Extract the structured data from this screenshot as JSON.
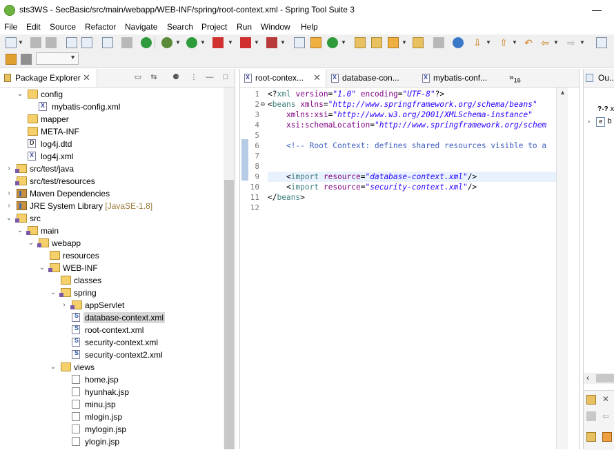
{
  "window": {
    "title": "sts3WS - SecBasic/src/main/webapp/WEB-INF/spring/root-context.xml - Spring Tool Suite 3",
    "minimize": "—"
  },
  "menu": [
    "File",
    "Edit",
    "Source",
    "Refactor",
    "Navigate",
    "Search",
    "Project",
    "Run",
    "Window",
    "Help"
  ],
  "package_explorer": {
    "title": "Package Explorer",
    "close": "✕",
    "tree": [
      {
        "label": "config",
        "icon": "folder",
        "depth": 0,
        "twisty": "open"
      },
      {
        "label": "mybatis-config.xml",
        "icon": "xml-file",
        "depth": 1,
        "twisty": ""
      },
      {
        "label": "mapper",
        "icon": "folder",
        "depth": 0,
        "twisty": ""
      },
      {
        "label": "META-INF",
        "icon": "folder",
        "depth": 0,
        "twisty": ""
      },
      {
        "label": "log4j.dtd",
        "icon": "dtd-file",
        "depth": 0,
        "twisty": ""
      },
      {
        "label": "log4j.xml",
        "icon": "xml-file",
        "depth": 0,
        "twisty": ""
      },
      {
        "label": "src/test/java",
        "icon": "source-folder",
        "depth": -1,
        "twisty": "closed"
      },
      {
        "label": "src/test/resources",
        "icon": "source-folder",
        "depth": -1,
        "twisty": ""
      },
      {
        "label": "Maven Dependencies",
        "icon": "library",
        "depth": -1,
        "twisty": "closed"
      },
      {
        "label": "JRE System Library",
        "suffix": "[JavaSE-1.8]",
        "icon": "library",
        "depth": -1,
        "twisty": "closed"
      },
      {
        "label": "src",
        "icon": "source-folder",
        "depth": -1,
        "twisty": "open"
      },
      {
        "label": "main",
        "icon": "source-folder",
        "depth": 0,
        "twisty": "open"
      },
      {
        "label": "webapp",
        "icon": "source-folder",
        "depth": 1,
        "twisty": "open"
      },
      {
        "label": "resources",
        "icon": "folder",
        "depth": 2,
        "twisty": ""
      },
      {
        "label": "WEB-INF",
        "icon": "source-folder",
        "depth": 2,
        "twisty": "open"
      },
      {
        "label": "classes",
        "icon": "folder",
        "depth": 3,
        "twisty": ""
      },
      {
        "label": "spring",
        "icon": "source-folder",
        "depth": 3,
        "twisty": "open"
      },
      {
        "label": "appServlet",
        "icon": "source-folder",
        "depth": 4,
        "twisty": "closed"
      },
      {
        "label": "database-context.xml",
        "icon": "spring-xml-file",
        "depth": 4,
        "twisty": "",
        "selected": true
      },
      {
        "label": "root-context.xml",
        "icon": "spring-xml-file",
        "depth": 4,
        "twisty": ""
      },
      {
        "label": "security-context.xml",
        "icon": "spring-xml-file",
        "depth": 4,
        "twisty": ""
      },
      {
        "label": "security-context2.xml",
        "icon": "spring-xml-file",
        "depth": 4,
        "twisty": ""
      },
      {
        "label": "views",
        "icon": "folder",
        "depth": 3,
        "twisty": "open"
      },
      {
        "label": "home.jsp",
        "icon": "jsp-file",
        "depth": 4,
        "twisty": ""
      },
      {
        "label": "hyunhak.jsp",
        "icon": "jsp-file",
        "depth": 4,
        "twisty": ""
      },
      {
        "label": "minu.jsp",
        "icon": "jsp-file",
        "depth": 4,
        "twisty": ""
      },
      {
        "label": "mlogin.jsp",
        "icon": "jsp-file",
        "depth": 4,
        "twisty": ""
      },
      {
        "label": "mylogin.jsp",
        "icon": "jsp-file",
        "depth": 4,
        "twisty": ""
      },
      {
        "label": "ylogin.jsp",
        "icon": "jsp-file",
        "depth": 4,
        "twisty": ""
      }
    ]
  },
  "editor": {
    "tabs": [
      {
        "label": "root-contex...",
        "active": true,
        "close": "✕"
      },
      {
        "label": "database-con...",
        "active": false
      },
      {
        "label": "mybatis-conf...",
        "active": false
      }
    ],
    "overflow": {
      "symbol": "»",
      "count": "16"
    },
    "lines": [
      {
        "n": "1",
        "parts": [
          [
            "pun",
            "<?"
          ],
          [
            "tag",
            "xml"
          ],
          [
            "pun",
            " "
          ],
          [
            "attr",
            "version"
          ],
          [
            "pun",
            "="
          ],
          [
            "str",
            "\"1.0\""
          ],
          [
            "pun",
            " "
          ],
          [
            "attr",
            "encoding"
          ],
          [
            "pun",
            "="
          ],
          [
            "str",
            "\"UTF-8\""
          ],
          [
            "pun",
            "?>"
          ]
        ]
      },
      {
        "n": "2",
        "fold": "⊖",
        "parts": [
          [
            "pun",
            "<"
          ],
          [
            "tag",
            "beans"
          ],
          [
            "pun",
            " "
          ],
          [
            "attr",
            "xmlns"
          ],
          [
            "pun",
            "="
          ],
          [
            "str",
            "\"http://www.springframework.org/schema/beans\""
          ]
        ]
      },
      {
        "n": "3",
        "parts": [
          [
            "pun",
            "    "
          ],
          [
            "attr",
            "xmlns:xsi"
          ],
          [
            "pun",
            "="
          ],
          [
            "str",
            "\"http://www.w3.org/2001/XMLSchema-instance\""
          ]
        ]
      },
      {
        "n": "4",
        "parts": [
          [
            "pun",
            "    "
          ],
          [
            "attr",
            "xsi:schemaLocation"
          ],
          [
            "pun",
            "="
          ],
          [
            "str",
            "\"http://www.springframework.org/schem"
          ]
        ]
      },
      {
        "n": "5",
        "parts": []
      },
      {
        "n": "6",
        "parts": [
          [
            "pun",
            "    "
          ],
          [
            "com",
            "<!-- Root Context: defines shared resources visible to a"
          ]
        ]
      },
      {
        "n": "7",
        "parts": []
      },
      {
        "n": "8",
        "parts": []
      },
      {
        "n": "9",
        "hl": true,
        "parts": [
          [
            "pun",
            "    <"
          ],
          [
            "tag",
            "import"
          ],
          [
            "pun",
            " "
          ],
          [
            "attr",
            "resource"
          ],
          [
            "pun",
            "="
          ],
          [
            "str",
            "\"database-context.xml\""
          ],
          [
            "pun",
            "/>"
          ]
        ]
      },
      {
        "n": "10",
        "parts": [
          [
            "pun",
            "    <"
          ],
          [
            "tag",
            "import"
          ],
          [
            "pun",
            " "
          ],
          [
            "attr",
            "resource"
          ],
          [
            "pun",
            "="
          ],
          [
            "str",
            "\"security-context.xml\""
          ],
          [
            "pun",
            "/>"
          ]
        ]
      },
      {
        "n": "11",
        "parts": [
          [
            "pun",
            "</"
          ],
          [
            "tag",
            "beans"
          ],
          [
            "pun",
            ">"
          ]
        ]
      },
      {
        "n": "12",
        "parts": []
      }
    ]
  },
  "outline": {
    "title": "Ou...",
    "rows": [
      {
        "icon": "?-?",
        "label": "x"
      },
      {
        "icon": "e",
        "label": "b"
      }
    ]
  },
  "colors": {
    "selection": "#d8d8d8",
    "current_line": "#e8f2fe",
    "tag": "#3f7f7f",
    "attribute": "#7f007f",
    "string": "#2a00ff",
    "comment": "#3f5fbf"
  }
}
